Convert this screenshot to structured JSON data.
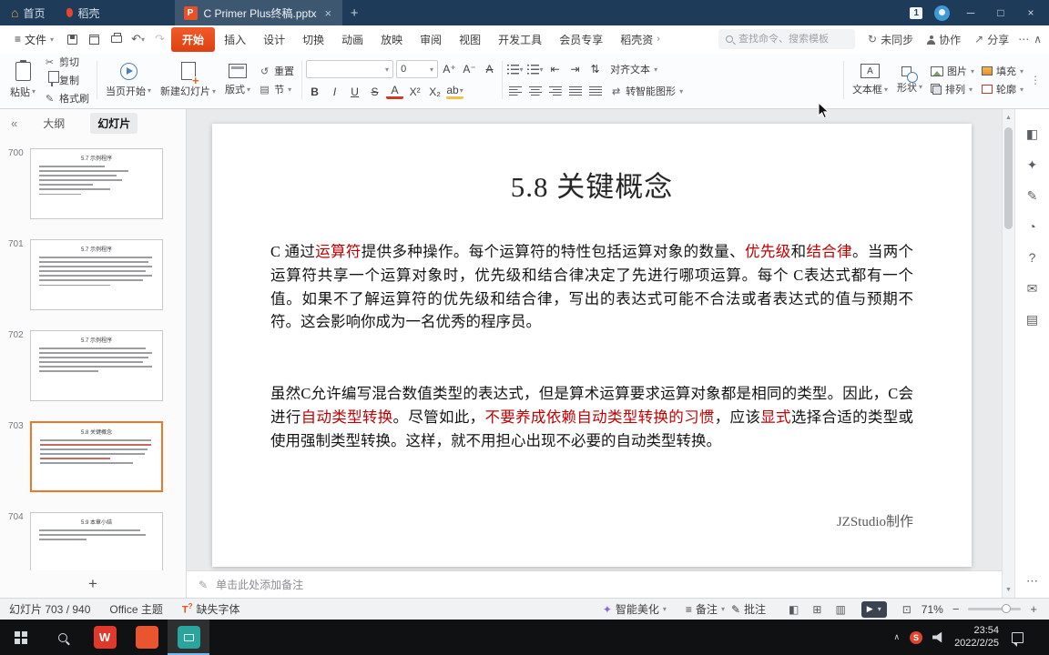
{
  "titlebar": {
    "home": "首页",
    "docer": "稻壳",
    "doc_title": "C Primer Plus终稿.pptx",
    "badge": "1"
  },
  "menubar": {
    "file": "文件",
    "tabs": [
      "开始",
      "插入",
      "设计",
      "切换",
      "动画",
      "放映",
      "审阅",
      "视图",
      "开发工具",
      "会员专享",
      "稻壳资源"
    ],
    "search_placeholder": "查找命令、搜索模板",
    "sync": "未同步",
    "collab": "协作",
    "share": "分享"
  },
  "toolbar": {
    "paste": "粘贴",
    "cut": "剪切",
    "copy": "复制",
    "format_painter": "格式刷",
    "play_current": "当页开始",
    "new_slide": "新建幻灯片",
    "layout": "版式",
    "reset": "重置",
    "section": "节",
    "font_size": "0",
    "font_inc": "A⁺",
    "font_dec": "A⁻",
    "bold": "B",
    "italic": "I",
    "underline": "U",
    "strike": "S",
    "font_color": "A",
    "sup": "X²",
    "sub": "X₂",
    "align_text": "对齐文本",
    "smart_graphic": "转智能图形",
    "text_box": "文本框",
    "shapes": "形状",
    "picture": "图片",
    "arrange": "排列",
    "fill": "填充",
    "outline": "轮廓"
  },
  "slides_panel": {
    "outline_tab": "大纲",
    "slides_tab": "幻灯片",
    "add": "+",
    "thumbnails": [
      {
        "num": "700",
        "title": "5.7 示例程序"
      },
      {
        "num": "701",
        "title": "5.7 示例程序"
      },
      {
        "num": "702",
        "title": "5.7 示例程序"
      },
      {
        "num": "703",
        "title": "5.8 关键概念"
      },
      {
        "num": "704",
        "title": "5.9 本章小结"
      }
    ]
  },
  "slide": {
    "title": "5.8 关键概念",
    "para1": [
      {
        "t": "C 通过"
      },
      {
        "t": "运算符",
        "red": true
      },
      {
        "t": "提供多种操作。每个运算符的特性包括运算对象的数量、"
      },
      {
        "t": "优先级",
        "red": true
      },
      {
        "t": "和"
      },
      {
        "t": "结合律",
        "red": true
      },
      {
        "t": "。当两个运算符共享一个运算对象时，优先级和结合律决定了先进行哪项运算。每个 C表达式都有一个值。如果不了解运算符的优先级和结合律，写出的表达式可能不合法或者表达式的值与预期不符。这会影响你成为一名优秀的程序员。"
      }
    ],
    "para2": [
      {
        "t": "虽然C允许编写混合数值类型的表达式，但是算术运算要求运算对象都是相同的类型。因此，C会进行"
      },
      {
        "t": "自动类型转换",
        "red": true
      },
      {
        "t": "。尽管如此，"
      },
      {
        "t": "不要养成依赖自动类型转换的习惯",
        "red": true
      },
      {
        "t": "，应该"
      },
      {
        "t": "显式",
        "red": true
      },
      {
        "t": "选择合适的类型或使用强制类型转换。这样，就不用担心出现不必要的自动类型转换。"
      }
    ],
    "credit": "JZStudio制作"
  },
  "notes": {
    "placeholder": "单击此处添加备注"
  },
  "statusbar": {
    "slide_counter": "幻灯片 703 / 940",
    "theme": "Office 主题",
    "missing_font": "缺失字体",
    "beautify": "智能美化",
    "notes_label": "备注",
    "comments_label": "批注",
    "zoom": "71%"
  },
  "taskbar": {
    "time": "23:54",
    "date": "2022/2/25"
  }
}
